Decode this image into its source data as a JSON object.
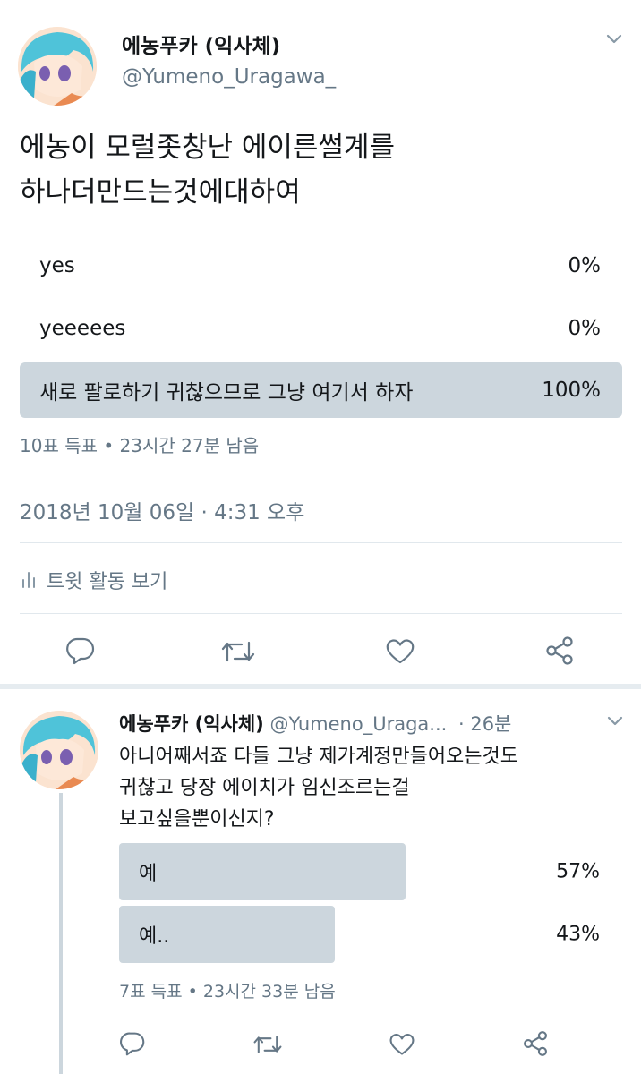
{
  "main_tweet": {
    "display_name": "에농푸카 (익사체)",
    "handle": "@Yumeno_Uragawa_",
    "text_line1": "에농이 모럴좃창난 에이른썰계를",
    "text_line2": "하나더만드는것에대하여",
    "poll": {
      "options": [
        {
          "label": "yes",
          "percent_text": "0%",
          "percent": 0
        },
        {
          "label": "yeeeees",
          "percent_text": "0%",
          "percent": 0
        },
        {
          "label": "새로 팔로하기 귀찮으므로 그냥 여기서 하자",
          "percent_text": "100%",
          "percent": 100
        }
      ],
      "meta": "10표 득표 • 23시간 27분 남음"
    },
    "timestamp": "2018년 10월 06일 · 4:31 오후",
    "activity_label": "트윗 활동 보기"
  },
  "reply_tweet": {
    "display_name": "에농푸카 (익사체)",
    "handle": "@Yumeno_Uraga...",
    "time": "· 26분",
    "text_line1": "아니어째서죠 다들 그냥 제가계정만들어오는것도",
    "text_line2": "귀찮고 당장 에이치가 임신조르는걸",
    "text_line3": "보고싶을뿐이신지?",
    "poll": {
      "options": [
        {
          "label": "예",
          "percent_text": "57%",
          "percent": 57
        },
        {
          "label": "예..",
          "percent_text": "43%",
          "percent": 43
        }
      ],
      "meta": "7표 득표 • 23시간 33분 남음"
    }
  },
  "icons": [
    "chevron-down-icon",
    "reply-icon",
    "retweet-icon",
    "like-icon",
    "share-icon",
    "bar-chart-icon"
  ],
  "colors": {
    "text": "#14171a",
    "secondary": "#657786",
    "poll_fill": "#ccd6dd",
    "divider": "#e1e8ed"
  }
}
